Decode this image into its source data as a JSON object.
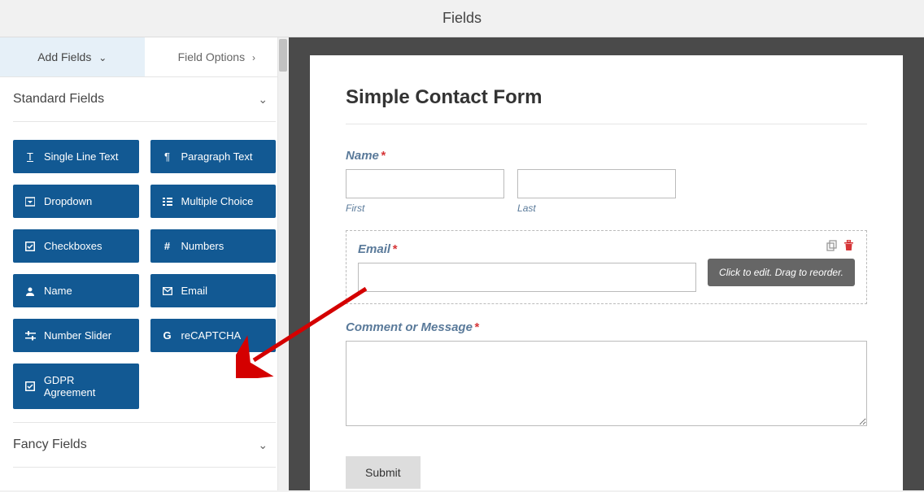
{
  "page": {
    "title": "Fields"
  },
  "tabs": {
    "add_fields": "Add Fields",
    "field_options": "Field Options"
  },
  "sections": {
    "standard": {
      "title": "Standard Fields",
      "items": [
        {
          "icon": "T",
          "label": "Single Line Text"
        },
        {
          "icon": "¶",
          "label": "Paragraph Text"
        },
        {
          "icon": "▾",
          "label": "Dropdown"
        },
        {
          "icon": "≡",
          "label": "Multiple Choice"
        },
        {
          "icon": "☑",
          "label": "Checkboxes"
        },
        {
          "icon": "#",
          "label": "Numbers"
        },
        {
          "icon": "👤",
          "label": "Name"
        },
        {
          "icon": "✉",
          "label": "Email"
        },
        {
          "icon": "⇆",
          "label": "Number Slider"
        },
        {
          "icon": "G",
          "label": "reCAPTCHA"
        },
        {
          "icon": "☑",
          "label": "GDPR Agreement"
        }
      ]
    },
    "fancy": {
      "title": "Fancy Fields"
    }
  },
  "form": {
    "title": "Simple Contact Form",
    "name_label": "Name",
    "first_sub": "First",
    "last_sub": "Last",
    "email_label": "Email",
    "email_tooltip": "Click to edit. Drag to reorder.",
    "comment_label": "Comment or Message",
    "submit_label": "Submit"
  }
}
